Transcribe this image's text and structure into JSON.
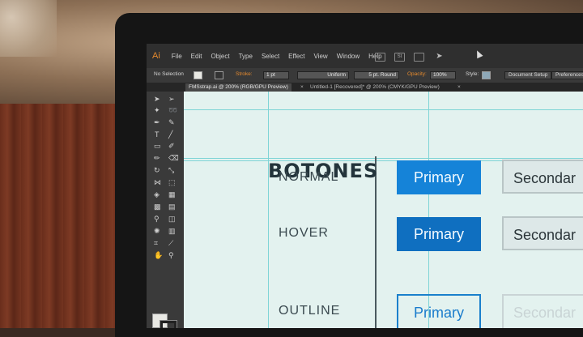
{
  "menubar": {
    "app_logo": "Ai",
    "items": [
      "File",
      "Edit",
      "Object",
      "Type",
      "Select",
      "Effect",
      "View",
      "Window",
      "Help"
    ],
    "icons": [
      "bridge-icon",
      "stock-icon",
      "arrange-documents-icon",
      "sync-icon"
    ]
  },
  "controlbar": {
    "selection": "No Selection",
    "stroke_label": "Stroke:",
    "stroke_weight": "1 pt",
    "stroke_profile": "Uniform",
    "brush": "5 pt. Round",
    "opacity_label": "Opacity:",
    "opacity_value": "100%",
    "style_label": "Style:",
    "document_setup": "Document Setup",
    "preferences": "Preferences"
  },
  "tabs": [
    {
      "label": "FMSstrap.ai @ 200% (RGB/GPU Preview)",
      "active": true
    },
    {
      "label": "Untitled-1 [Recovered]* @ 200% (CMYK/GPU Preview)",
      "active": false
    }
  ],
  "canvas": {
    "title": "BOTONES",
    "rows": [
      {
        "label": "NORMAL",
        "primary": "Primary",
        "secondary": "Secondar"
      },
      {
        "label": "HOVER",
        "primary": "Primary",
        "secondary": "Secondar"
      },
      {
        "label": "OUTLINE",
        "primary": "Primary",
        "secondary": "Secondar"
      }
    ]
  },
  "colors": {
    "primary": "#1583d8",
    "primary_hover": "#0f6fc0",
    "accent": "#e58a2e",
    "canvas_bg": "#e3f2ef"
  }
}
